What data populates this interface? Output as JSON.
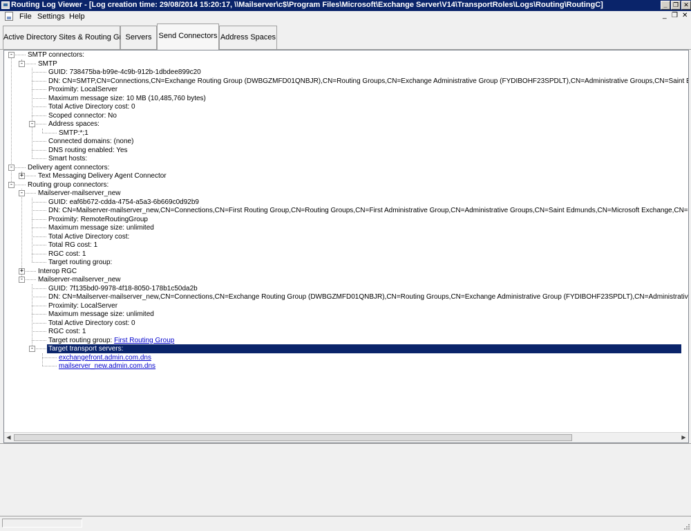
{
  "window": {
    "title": "Routing Log Viewer - [Log creation time: 29/08/2014 15:20:17, \\\\Mailserver\\c$\\Program Files\\Microsoft\\Exchange Server\\V14\\TransportRoles\\Logs\\Routing\\RoutingC]",
    "minimize_glyph": "_",
    "maximize_glyph": "❐",
    "close_glyph": "✕"
  },
  "menu": {
    "items": [
      "File",
      "Settings",
      "Help"
    ],
    "mdi_minimize": "_",
    "mdi_restore": "❐",
    "mdi_close": "✕"
  },
  "tabs": [
    {
      "label": "Active Directory Sites & Routing Groups",
      "active": false
    },
    {
      "label": "Servers",
      "active": false
    },
    {
      "label": "Send Connectors",
      "active": true
    },
    {
      "label": "Address Spaces",
      "active": false
    }
  ],
  "tree": [
    {
      "depth": 0,
      "exp": "-",
      "label": "SMTP connectors:"
    },
    {
      "depth": 1,
      "exp": "-",
      "label": "SMTP"
    },
    {
      "depth": 2,
      "label": "GUID:",
      "value": "738475ba-b99e-4c9b-912b-1dbdee899c20"
    },
    {
      "depth": 2,
      "label": "DN:",
      "value": "CN=SMTP,CN=Connections,CN=Exchange Routing Group (DWBGZMFD01QNBJR),CN=Routing Groups,CN=Exchange Administrative Group (FYDIBOHF23SPDLT),CN=Administrative Groups,CN=Saint Edmunds,CN=Microsoft Exchange"
    },
    {
      "depth": 2,
      "label": "Proximity:",
      "value": "LocalServer"
    },
    {
      "depth": 2,
      "label": "Maximum message size:",
      "value": "10 MB (10,485,760 bytes)"
    },
    {
      "depth": 2,
      "label": "Total Active Directory cost:",
      "value": "0"
    },
    {
      "depth": 2,
      "label": "Scoped connector:",
      "value": "No"
    },
    {
      "depth": 2,
      "exp": "-",
      "label": "Address spaces:"
    },
    {
      "depth": 3,
      "label": "SMTP:*;1"
    },
    {
      "depth": 2,
      "label": "Connected domains:",
      "value": "(none)"
    },
    {
      "depth": 2,
      "label": "DNS routing enabled:",
      "value": "Yes"
    },
    {
      "depth": 2,
      "label": "Smart hosts:"
    },
    {
      "depth": 0,
      "exp": "-",
      "label": "Delivery agent connectors:"
    },
    {
      "depth": 1,
      "exp": "+",
      "label": "Text Messaging Delivery Agent Connector"
    },
    {
      "depth": 0,
      "exp": "-",
      "label": "Routing group connectors:"
    },
    {
      "depth": 1,
      "exp": "-",
      "label": "Mailserver-mailserver_new"
    },
    {
      "depth": 2,
      "label": "GUID:",
      "value": "eaf6b672-cdda-4754-a5a3-6b669c0d92b9"
    },
    {
      "depth": 2,
      "label": "DN:",
      "value": "CN=Mailserver-mailserver_new,CN=Connections,CN=First Routing Group,CN=Routing Groups,CN=First Administrative Group,CN=Administrative Groups,CN=Saint Edmunds,CN=Microsoft Exchange,CN=Services,CN=Configuration,DC"
    },
    {
      "depth": 2,
      "label": "Proximity:",
      "value": "RemoteRoutingGroup"
    },
    {
      "depth": 2,
      "label": "Maximum message size:",
      "value": "unlimited"
    },
    {
      "depth": 2,
      "label": "Total Active Directory cost:"
    },
    {
      "depth": 2,
      "label": "Total RG cost:",
      "value": "1"
    },
    {
      "depth": 2,
      "label": "RGC cost:",
      "value": "1"
    },
    {
      "depth": 2,
      "label": "Target routing group:"
    },
    {
      "depth": 1,
      "exp": "+",
      "label": "Interop RGC"
    },
    {
      "depth": 1,
      "exp": "-",
      "label": "Mailserver-mailserver_new"
    },
    {
      "depth": 2,
      "label": "GUID:",
      "value": "7f135bd0-9978-4f18-8050-178b1c50da2b"
    },
    {
      "depth": 2,
      "label": "DN:",
      "value": "CN=Mailserver-mailserver_new,CN=Connections,CN=Exchange Routing Group (DWBGZMFD01QNBJR),CN=Routing Groups,CN=Exchange Administrative Group (FYDIBOHF23SPDLT),CN=Administrative Groups,CN=Saint Edmunds,CN=M"
    },
    {
      "depth": 2,
      "label": "Proximity:",
      "value": "LocalServer"
    },
    {
      "depth": 2,
      "label": "Maximum message size:",
      "value": "unlimited"
    },
    {
      "depth": 2,
      "label": "Total Active Directory cost:",
      "value": "0"
    },
    {
      "depth": 2,
      "label": "RGC cost:",
      "value": "1"
    },
    {
      "depth": 2,
      "label": "Target routing group:",
      "value": "First Routing Group",
      "link": true
    },
    {
      "depth": 2,
      "exp": "-",
      "label": "Target transport servers:",
      "selected": true
    },
    {
      "depth": 3,
      "label": "exchangefront.admin.com.dns",
      "link": true
    },
    {
      "depth": 3,
      "label": "mailserver_new.admin.com.dns",
      "link": true
    }
  ],
  "scrollbar": {
    "left_arrow": "◀",
    "right_arrow": "▶"
  }
}
